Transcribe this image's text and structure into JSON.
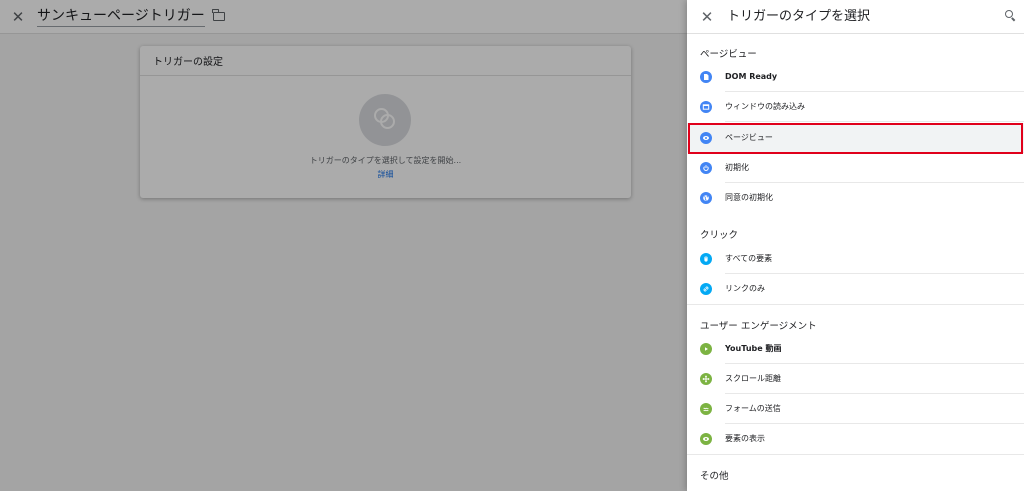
{
  "background": {
    "title": "サンキューページトリガー",
    "close_glyph": "✕",
    "card": {
      "header": "トリガーの設定",
      "prompt": "トリガーのタイプを選択して設定を開始...",
      "link": "詳細"
    }
  },
  "panel": {
    "close_glyph": "✕",
    "title": "トリガーのタイプを選択",
    "sections": [
      {
        "label": "ページビュー",
        "items": [
          {
            "label": "DOM Ready",
            "icon": "document-icon",
            "color": "#4285f4"
          },
          {
            "label": "ウィンドウの読み込み",
            "icon": "window-icon",
            "color": "#4285f4"
          },
          {
            "label": "ページビュー",
            "icon": "eye-icon",
            "color": "#4285f4"
          },
          {
            "label": "初期化",
            "icon": "power-icon",
            "color": "#4285f4"
          },
          {
            "label": "同意の初期化",
            "icon": "globe-icon",
            "color": "#4285f4"
          }
        ]
      },
      {
        "label": "クリック",
        "items": [
          {
            "label": "すべての要素",
            "icon": "mouse-icon",
            "color": "#03a9f4"
          },
          {
            "label": "リンクのみ",
            "icon": "link-icon",
            "color": "#03a9f4"
          }
        ]
      },
      {
        "label": "ユーザー エンゲージメント",
        "items": [
          {
            "label": "YouTube 動画",
            "icon": "play-icon",
            "color": "#7cb342"
          },
          {
            "label": "スクロール距離",
            "icon": "scroll-icon",
            "color": "#7cb342"
          },
          {
            "label": "フォームの送信",
            "icon": "form-icon",
            "color": "#7cb342"
          },
          {
            "label": "要素の表示",
            "icon": "eye-icon",
            "color": "#7cb342"
          }
        ]
      },
      {
        "label": "その他",
        "items": []
      }
    ]
  }
}
